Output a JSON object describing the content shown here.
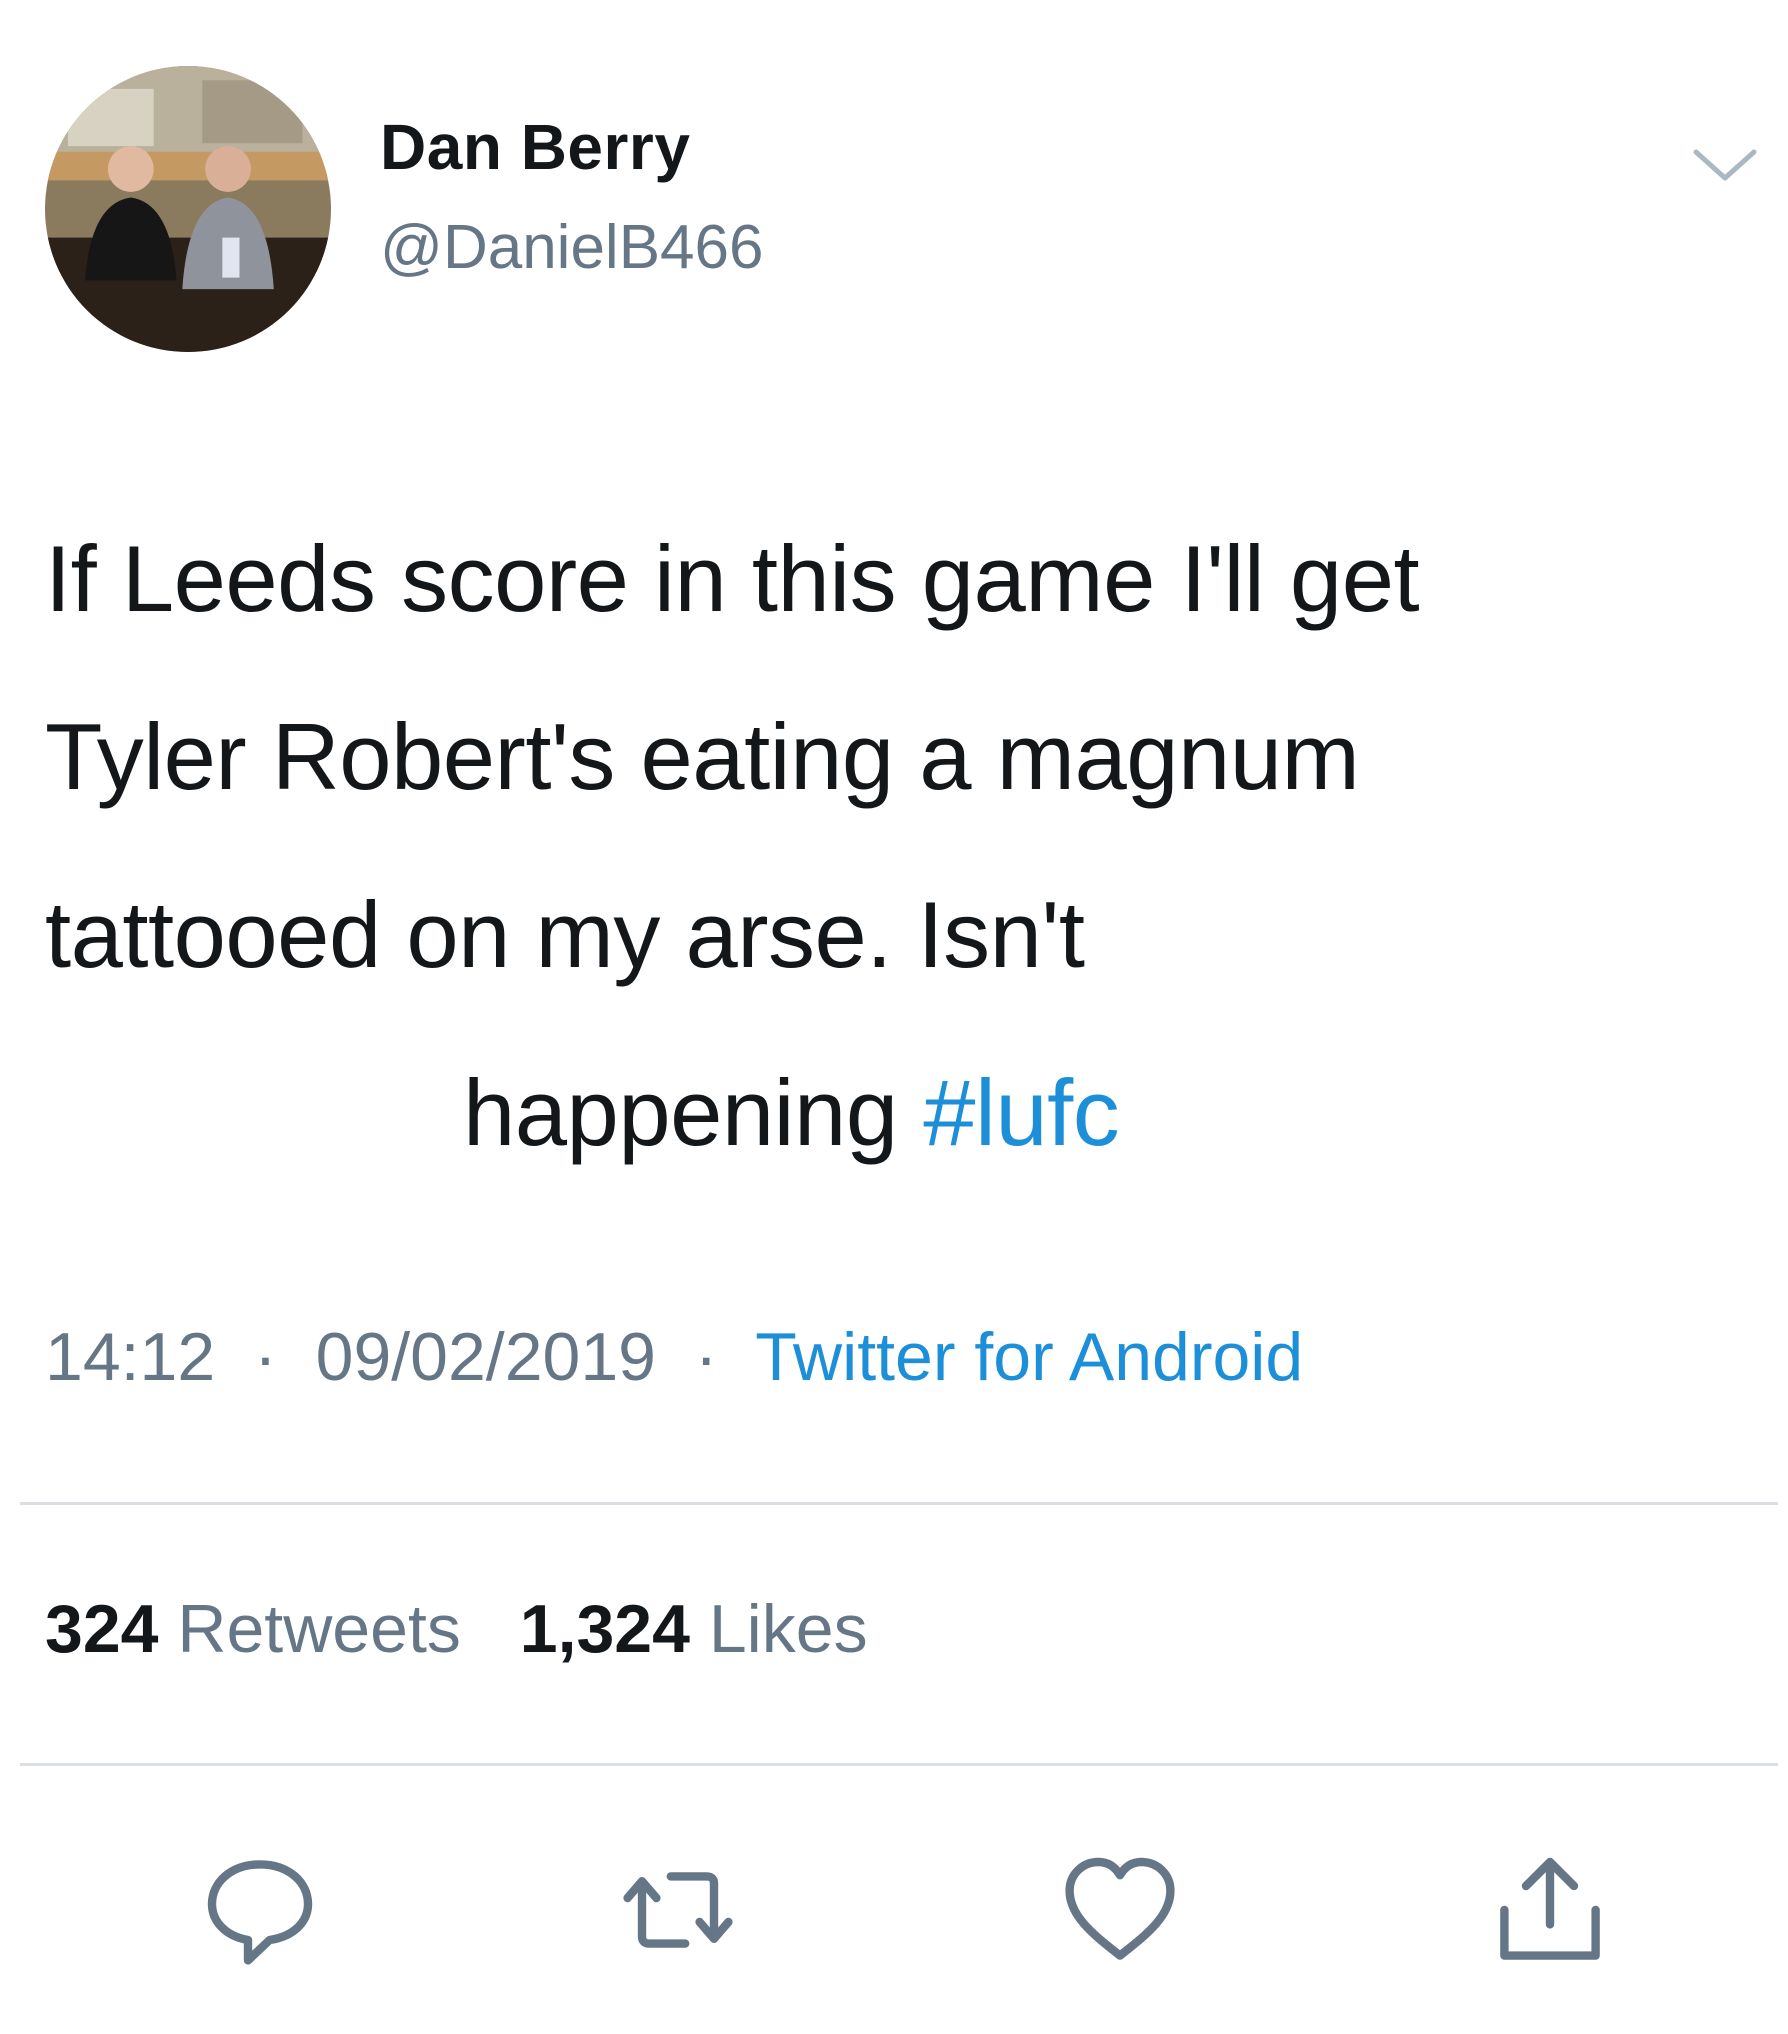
{
  "author": {
    "display_name": "Dan Berry",
    "handle": "@DanielB466"
  },
  "tweet": {
    "lines": [
      "If Leeds score in this game I'll get",
      "Tyler Robert's eating a magnum",
      "tattooed on my arse. Isn't"
    ],
    "last_line_text": "happening ",
    "hashtag": "#lufc"
  },
  "meta": {
    "time": "14:12",
    "separator": "·",
    "date": "09/02/2019",
    "source": "Twitter for Android"
  },
  "stats": {
    "retweets_count": "324",
    "retweets_label": "Retweets",
    "likes_count": "1,324",
    "likes_label": "Likes"
  },
  "actions": [
    "reply-icon",
    "retweet-icon",
    "like-icon",
    "share-icon"
  ],
  "colors": {
    "text": "#14171a",
    "secondary": "#657786",
    "link": "#1d8fd8",
    "divider": "#d9dfe3"
  }
}
